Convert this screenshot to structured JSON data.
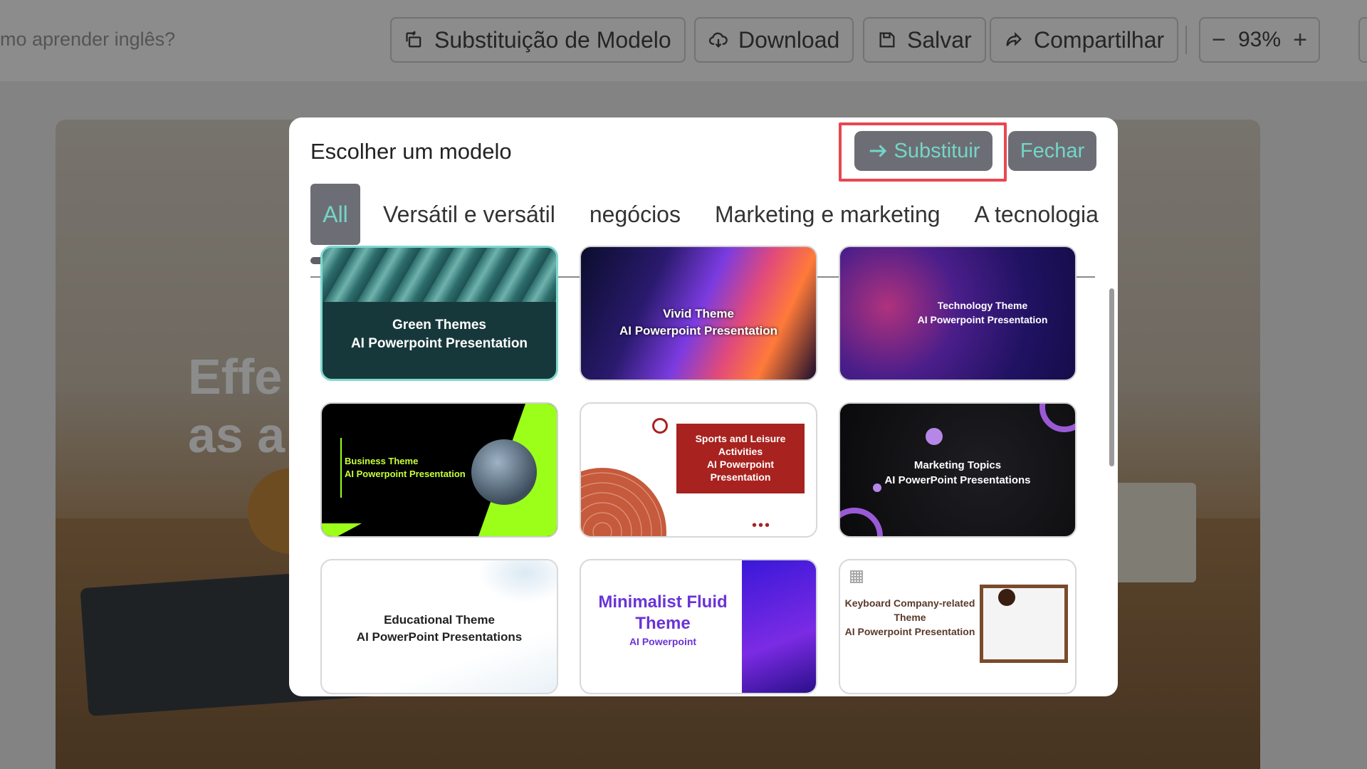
{
  "app": {
    "doc_title": "mo aprender inglês?",
    "toolbar": {
      "template_replace_label": "Substituição de Modelo",
      "download_label": "Download",
      "save_label": "Salvar",
      "share_label": "Compartilhar",
      "zoom_minus": "−",
      "zoom_value": "93%",
      "zoom_plus": "+"
    },
    "slide": {
      "line1": "Effe",
      "line2": "as a"
    }
  },
  "modal": {
    "title": "Escolher um modelo",
    "replace_label": "Substituir",
    "close_label": "Fechar",
    "tabs": [
      {
        "label": "All",
        "active": true
      },
      {
        "label": "Versátil e versátil",
        "active": false
      },
      {
        "label": "negócios",
        "active": false
      },
      {
        "label": "Marketing e marketing",
        "active": false
      },
      {
        "label": "A tecnologia",
        "active": false
      }
    ],
    "templates": [
      {
        "line1": "Green Themes",
        "line2": "AI Powerpoint Presentation",
        "selected": true
      },
      {
        "line1": "Vivid Theme",
        "line2": "AI Powerpoint Presentation"
      },
      {
        "line1": "Technology Theme",
        "line2": "AI Powerpoint Presentation"
      },
      {
        "line1": "Business Theme",
        "line2": "AI Powerpoint Presentation"
      },
      {
        "line1": "Sports and Leisure Activities",
        "line2": "AI Powerpoint Presentation"
      },
      {
        "line1": "Marketing Topics",
        "line2": "AI PowerPoint Presentations"
      },
      {
        "line1": "Educational Theme",
        "line2": "AI PowerPoint Presentations"
      },
      {
        "line1": "Minimalist Fluid Theme",
        "line2": "AI Powerpoint"
      },
      {
        "line1": "Keyboard Company-related Theme",
        "line2": "AI Powerpoint Presentation"
      }
    ]
  },
  "colors": {
    "accent_text": "#73d6c8",
    "button_bg": "#6d6e75",
    "highlight": "#e8474f"
  }
}
